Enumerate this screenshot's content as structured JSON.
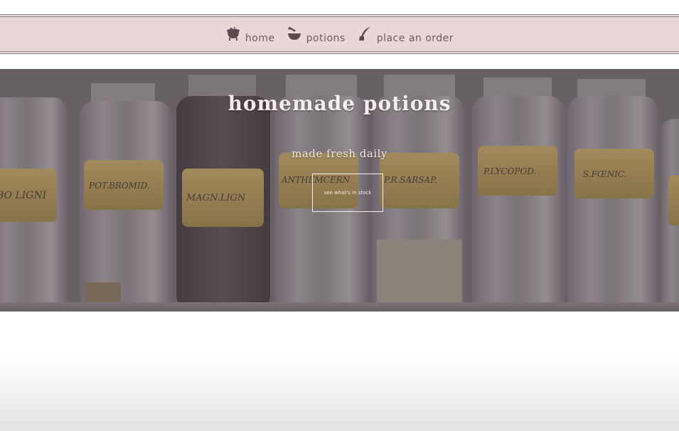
{
  "nav": {
    "items": [
      {
        "icon": "cauldron-icon",
        "label": "home"
      },
      {
        "icon": "mortar-pestle-icon",
        "label": "potions"
      },
      {
        "icon": "quill-icon",
        "label": "place an order"
      }
    ]
  },
  "hero": {
    "title": "homemade potions",
    "subtitle": "made fresh daily",
    "cta_label": "see what's in stock",
    "jar_labels": [
      "BO LIGNI",
      "POT.BROMID.",
      "MAGN.LIGN",
      "ANTHEMCERN",
      "P.R.SARSAP.",
      "P.LYCOPOD.",
      "S.FŒNIC."
    ]
  },
  "colors": {
    "nav_bg": "#ead6d8",
    "nav_text": "#6d5a5e",
    "hero_text": "#f4eef0"
  }
}
